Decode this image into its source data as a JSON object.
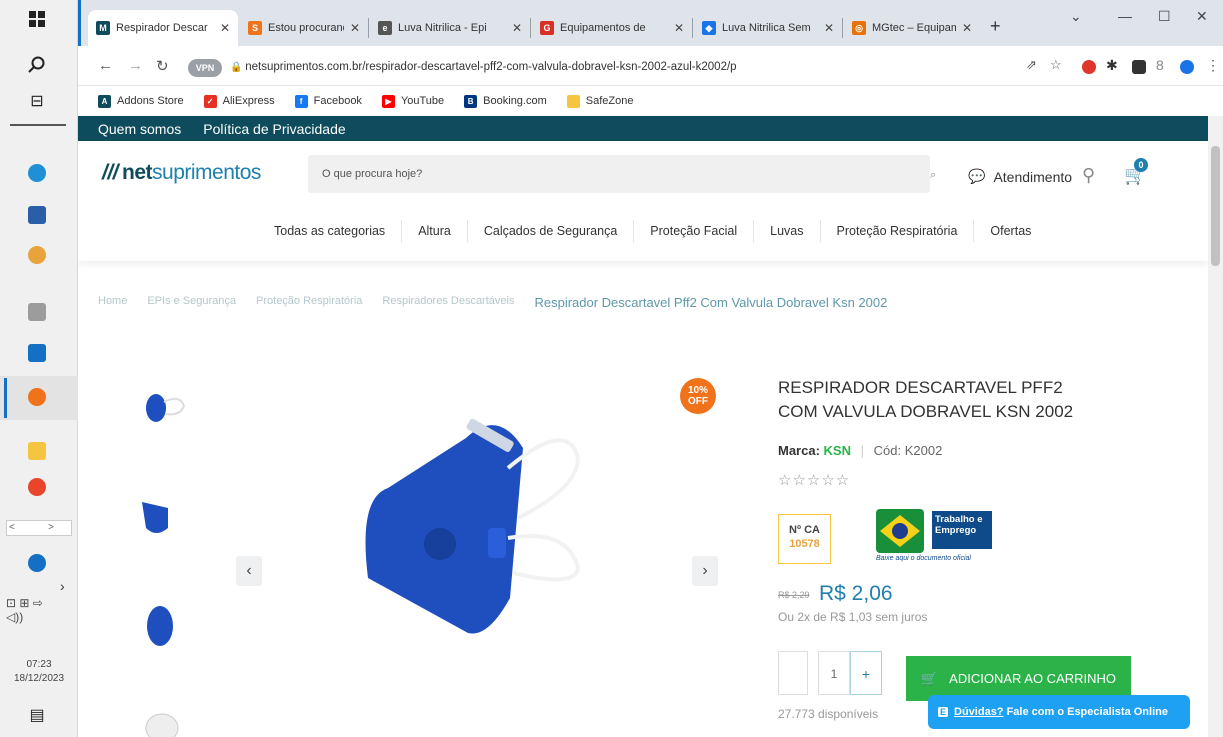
{
  "taskbar": {
    "clock_time": "07:23",
    "clock_date": "18/12/2023"
  },
  "browser": {
    "tabs": [
      {
        "label": "Respirador Descar",
        "fav": "M",
        "fav_color": "#0e4b5c",
        "active": true
      },
      {
        "label": "Estou procurando",
        "fav": "S",
        "fav_color": "#f0731c",
        "active": false
      },
      {
        "label": "Luva Nitrilica - Epi",
        "fav": "e",
        "fav_color": "#555555",
        "active": false
      },
      {
        "label": "Equipamentos de",
        "fav": "G",
        "fav_color": "#d93025",
        "active": false
      },
      {
        "label": "Luva Nitrilica Sem",
        "fav": "◆",
        "fav_color": "#1a73e8",
        "active": false
      },
      {
        "label": "MGtec – Equipame",
        "fav": "◎",
        "fav_color": "#e8710a",
        "active": false
      }
    ],
    "url": "netsuprimentos.com.br/respirador-descartavel-pff2-com-valvula-dobravel-ksn-2002-azul-k2002/p",
    "vpn": "VPN",
    "bookmarks": [
      {
        "label": "Addons Store",
        "icon": "A",
        "color": "#0e4b5c"
      },
      {
        "label": "AliExpress",
        "icon": "✓",
        "color": "#e43225"
      },
      {
        "label": "Facebook",
        "icon": "f",
        "color": "#1877f2"
      },
      {
        "label": "YouTube",
        "icon": "▶",
        "color": "#ff0000"
      },
      {
        "label": "Booking.com",
        "icon": "B",
        "color": "#003580"
      },
      {
        "label": "SafeZone",
        "icon": "",
        "color": "#f5c542"
      }
    ]
  },
  "site": {
    "topbar": [
      "Quem somos",
      "Política de Privacidade"
    ],
    "logo_mark": "///",
    "logo_bold": "net",
    "logo_rest": "suprimentos",
    "search_placeholder": "O que procura hoje?",
    "atendimento": "Atendimento",
    "cart_count": "0",
    "categories": [
      "Todas as categorias",
      "Altura",
      "Calçados de Segurança",
      "Proteção Facial",
      "Luvas",
      "Proteção Respiratória",
      "Ofertas"
    ],
    "breadcrumbs": [
      "Home",
      "EPIs e Segurança",
      "Proteção Respiratória",
      "Respiradores Descartáveis"
    ],
    "breadcrumb_current": "Respirador Descartavel Pff2 Com Valvula Dobravel Ksn 2002"
  },
  "product": {
    "discount_line1": "10%",
    "discount_line2": "OFF",
    "title": "RESPIRADOR DESCARTAVEL PFF2 COM VALVULA DOBRAVEL KSN 2002",
    "brand_label": "Marca:",
    "brand": "KSN",
    "code": "Cód: K2002",
    "stars": "☆☆☆☆☆",
    "ca_label": "Nº CA",
    "ca_value": "10578",
    "gov_line1": "Trabalho e",
    "gov_line2": "Emprego",
    "gov_link": "Baixe aqui o documento oficial",
    "price_old": "R$ 2,29",
    "price": "R$ 2,06",
    "installments": "Ou 2x de R$ 1,03 sem juros",
    "quantity": "1",
    "add_to_cart": "ADICIONAR AO CARRINHO",
    "stock": "27.773 disponíveis"
  },
  "chat": {
    "question": "Dúvidas?",
    "text": " Fale com o Especialista Online"
  }
}
